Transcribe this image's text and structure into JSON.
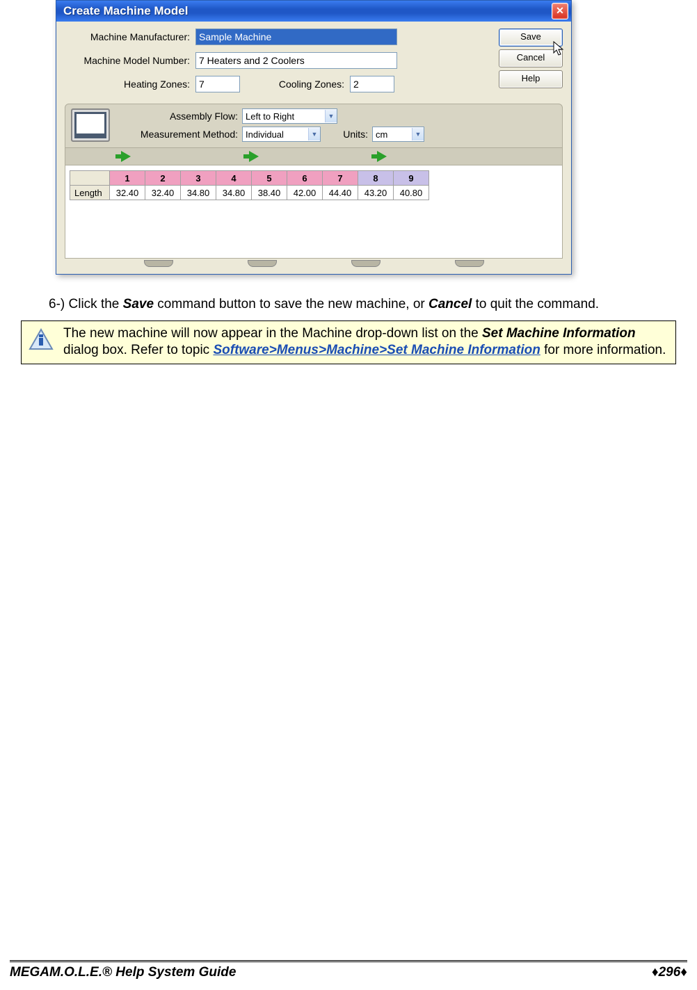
{
  "dialog": {
    "title": "Create Machine Model",
    "fields": {
      "manufacturer_label": "Machine Manufacturer:",
      "manufacturer_value": "Sample Machine",
      "model_label": "Machine Model Number:",
      "model_value": "7 Heaters and 2 Coolers",
      "heating_label": "Heating Zones:",
      "heating_value": "7",
      "cooling_label": "Cooling Zones:",
      "cooling_value": "2",
      "flow_label": "Assembly Flow:",
      "flow_value": "Left to Right",
      "method_label": "Measurement Method:",
      "method_value": "Individual",
      "units_label": "Units:",
      "units_value": "cm"
    },
    "buttons": {
      "save": "Save",
      "cancel": "Cancel",
      "help": "Help"
    },
    "zone_table": {
      "row_label": "Length",
      "headers": [
        "1",
        "2",
        "3",
        "4",
        "5",
        "6",
        "7",
        "8",
        "9"
      ],
      "heat_count": 7,
      "values": [
        "32.40",
        "32.40",
        "34.80",
        "34.80",
        "38.40",
        "42.00",
        "44.40",
        "43.20",
        "40.80"
      ]
    }
  },
  "instruction": {
    "prefix": "6-) Click the ",
    "save": "Save",
    "mid1": " command button to save the new machine, or ",
    "cancel": "Cancel",
    "suffix": " to quit the command."
  },
  "note": {
    "t1": "The new machine will now appear in the Machine drop-down list on the ",
    "b1": "Set Machine Information",
    "t2": " dialog box. Refer to topic ",
    "link": "Software>Menus>Machine>Set Machine Information",
    "t3": " for more information."
  },
  "footer": {
    "mega": "MEGA",
    "rest": "M.O.L.E.® Help System Guide",
    "page": "♦296♦"
  }
}
